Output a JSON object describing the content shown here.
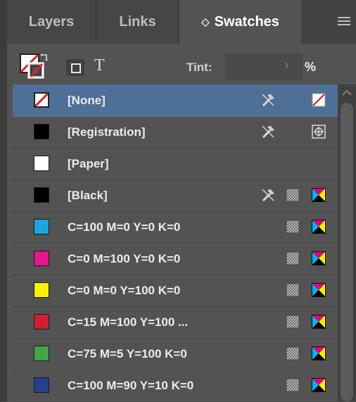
{
  "tabs": [
    {
      "label": "Layers"
    },
    {
      "label": "Links"
    },
    {
      "label": "Swatches",
      "chevron": "◇"
    }
  ],
  "toolbar": {
    "text_icon": "T",
    "tint_label": "Tint:",
    "tint_value": "",
    "tint_arrow": "›",
    "percent": "%"
  },
  "colors": {
    "selected_row": "#4e6f96",
    "panel_bg": "#535353"
  },
  "swatches": [
    {
      "name": "[None]",
      "chip": "none",
      "color": "#ffffff",
      "icons": [
        "no-edit-icon",
        "none-indicator-icon"
      ],
      "selected": true
    },
    {
      "name": "[Registration]",
      "chip": "solid",
      "color": "#000000",
      "icons": [
        "no-edit-icon",
        "registration-mark-icon"
      ]
    },
    {
      "name": "[Paper]",
      "chip": "solid",
      "color": "#ffffff",
      "icons": []
    },
    {
      "name": "[Black]",
      "chip": "solid",
      "color": "#000000",
      "icons": [
        "no-edit-icon",
        "process-color-icon",
        "cmyk-mode-icon"
      ]
    },
    {
      "name": "C=100 M=0 Y=0 K=0",
      "chip": "solid",
      "color": "#1aa7e0",
      "icons": [
        "process-color-icon",
        "cmyk-mode-icon"
      ]
    },
    {
      "name": "C=0 M=100 Y=0 K=0",
      "chip": "solid",
      "color": "#e3168e",
      "icons": [
        "process-color-icon",
        "cmyk-mode-icon"
      ]
    },
    {
      "name": "C=0 M=0 Y=100 K=0",
      "chip": "solid",
      "color": "#fff000",
      "icons": [
        "process-color-icon",
        "cmyk-mode-icon"
      ]
    },
    {
      "name": "C=15 M=100 Y=100 ...",
      "chip": "solid",
      "color": "#cf2030",
      "icons": [
        "process-color-icon",
        "cmyk-mode-icon"
      ]
    },
    {
      "name": "C=75 M=5 Y=100 K=0",
      "chip": "solid",
      "color": "#44a546",
      "icons": [
        "process-color-icon",
        "cmyk-mode-icon"
      ]
    },
    {
      "name": "C=100 M=90 Y=10 K=0",
      "chip": "solid",
      "color": "#243e90",
      "icons": [
        "process-color-icon",
        "cmyk-mode-icon"
      ]
    }
  ]
}
